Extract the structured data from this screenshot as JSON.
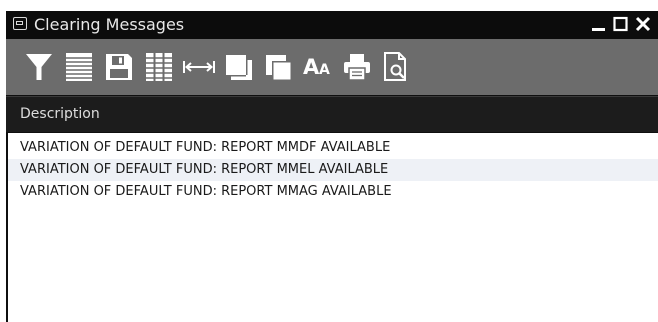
{
  "window": {
    "title": "Clearing Messages",
    "icon": "window-app-icon",
    "controls": [
      "minimize-icon",
      "maximize-icon",
      "close-icon"
    ]
  },
  "toolbar": {
    "tools": [
      {
        "name": "filter-icon"
      },
      {
        "name": "rows-icon"
      },
      {
        "name": "save-icon"
      },
      {
        "name": "columns-icon"
      },
      {
        "name": "fit-width-icon"
      },
      {
        "name": "cascade-icon"
      },
      {
        "name": "tile-icon"
      },
      {
        "name": "font-size-icon",
        "label": "AA"
      },
      {
        "name": "print-icon"
      },
      {
        "name": "print-preview-icon"
      }
    ],
    "font_label_large": "A",
    "font_label_small": "A"
  },
  "table": {
    "columns": [
      "Description"
    ],
    "rows": [
      "VARIATION OF DEFAULT FUND: REPORT MMDF AVAILABLE",
      "VARIATION OF DEFAULT FUND: REPORT MMEL AVAILABLE",
      "VARIATION OF DEFAULT FUND: REPORT MMAG AVAILABLE"
    ]
  },
  "colors": {
    "titlebar": "#0c0c0c",
    "toolbar": "#6c6c6c",
    "header": "#1c1c1c",
    "row_alt": "#eef1f6"
  }
}
